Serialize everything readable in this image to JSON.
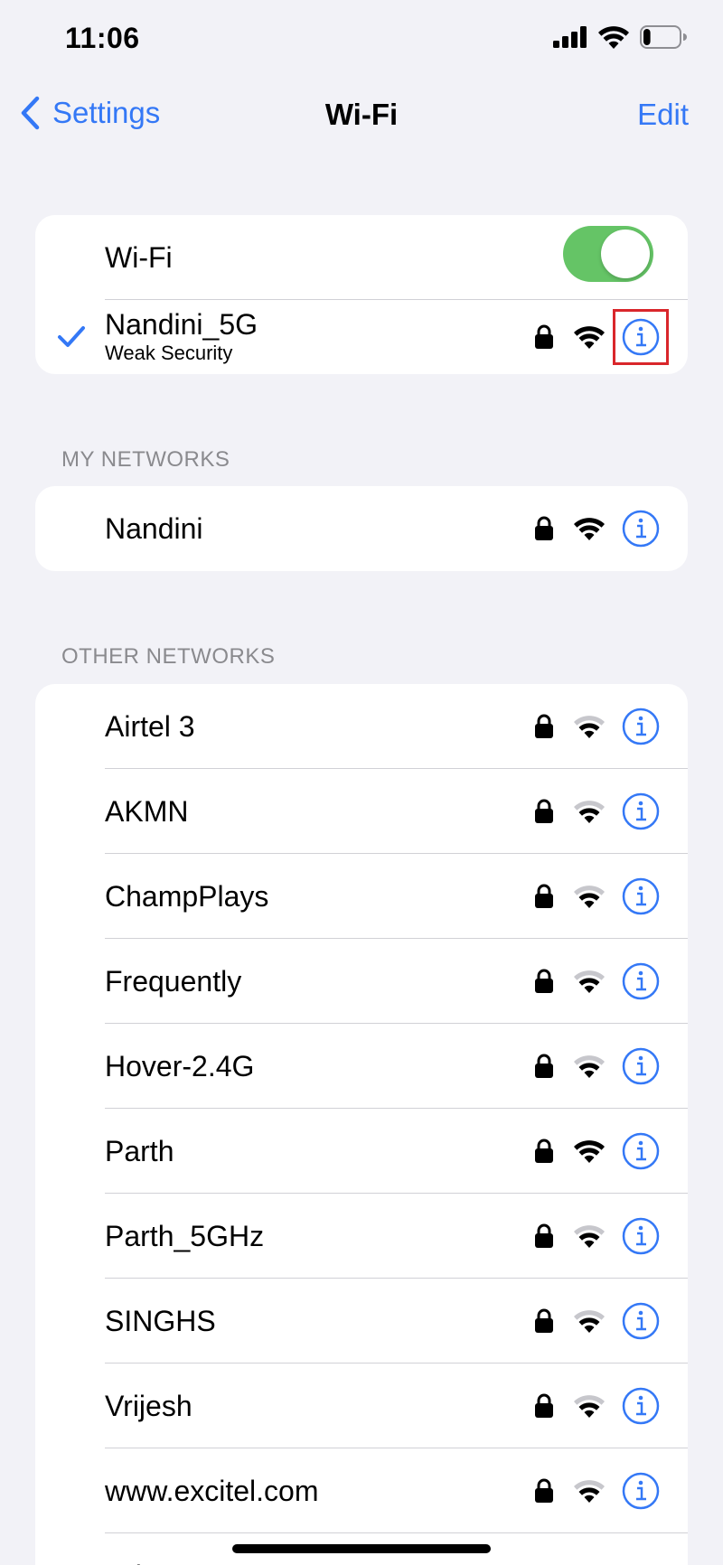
{
  "status_bar": {
    "time": "11:06",
    "battery_level": 0.2
  },
  "nav": {
    "back_label": "Settings",
    "title": "Wi-Fi",
    "edit_label": "Edit"
  },
  "wifi_toggle": {
    "label": "Wi-Fi",
    "on": true
  },
  "connected": {
    "name": "Nandini_5G",
    "subtitle": "Weak Security",
    "locked": true,
    "signal": "strong"
  },
  "my_networks": {
    "header": "MY NETWORKS",
    "items": [
      {
        "name": "Nandini",
        "locked": true,
        "signal": "strong"
      }
    ]
  },
  "other_networks": {
    "header": "OTHER NETWORKS",
    "items": [
      {
        "name": "Airtel 3",
        "locked": true,
        "signal": "weak"
      },
      {
        "name": "AKMN",
        "locked": true,
        "signal": "weak"
      },
      {
        "name": "ChampPlays",
        "locked": true,
        "signal": "weak"
      },
      {
        "name": "Frequently",
        "locked": true,
        "signal": "weak"
      },
      {
        "name": "Hover-2.4G",
        "locked": true,
        "signal": "weak"
      },
      {
        "name": "Parth",
        "locked": true,
        "signal": "strong"
      },
      {
        "name": "Parth_5GHz",
        "locked": true,
        "signal": "weak"
      },
      {
        "name": "SINGHS",
        "locked": true,
        "signal": "weak"
      },
      {
        "name": "Vrijesh",
        "locked": true,
        "signal": "weak"
      },
      {
        "name": "www.excitel.com",
        "locked": true,
        "signal": "weak"
      },
      {
        "name": "Oth",
        "locked": false,
        "signal": "none"
      }
    ]
  },
  "colors": {
    "accent": "#3478f6",
    "toggle_on": "#65c466",
    "highlight": "#d9262b",
    "background": "#f2f2f7"
  }
}
